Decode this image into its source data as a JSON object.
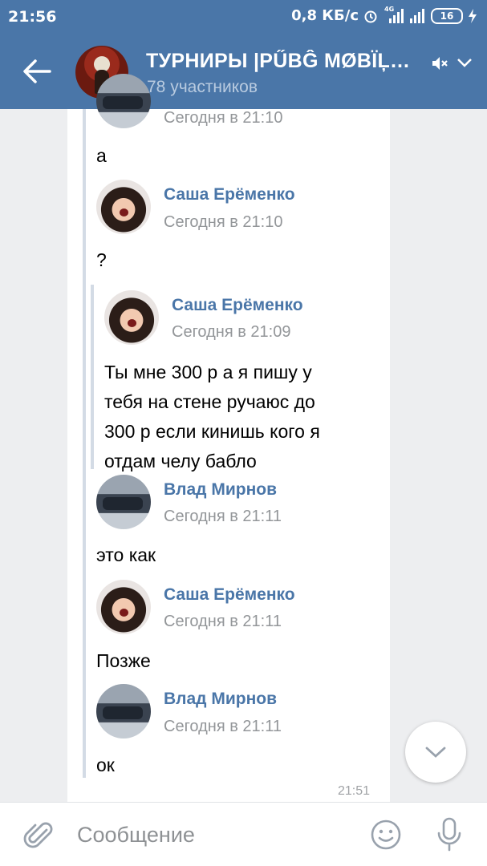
{
  "status_bar": {
    "time": "21:56",
    "net_speed": "0,8 КБ/с",
    "network_badge": "4G",
    "battery": "16"
  },
  "header": {
    "title": "ТУРНИРЫ |PŰBĜ MØBÏĻĘ... (",
    "subtitle": "78 участников"
  },
  "messages": [
    {
      "type": "text",
      "time": "Сегодня в 21:10",
      "text": "а"
    },
    {
      "type": "post",
      "author": "Саша Ерёменко",
      "time": "Сегодня в 21:10",
      "text": "?"
    },
    {
      "type": "quote",
      "author": "Саша Ерёменко",
      "time": "Сегодня в 21:09",
      "lines": [
        "Ты мне 300 р а я пишу у",
        "тебя на стене ручаюс до",
        "300 р если кинишь кого я",
        "отдам челу бабло"
      ]
    },
    {
      "type": "post",
      "author": "Влад Мирнов",
      "time": "Сегодня в 21:11",
      "text": "это как"
    },
    {
      "type": "post",
      "author": "Саша Ерёменко",
      "time": "Сегодня в 21:11",
      "text": "Позже"
    },
    {
      "type": "post",
      "author": "Влад Мирнов",
      "time": "Сегодня в 21:11",
      "text": "ок"
    }
  ],
  "message_time": "21:51",
  "composer": {
    "placeholder": "Сообщение"
  },
  "colors": {
    "header": "#4a76a8",
    "link": "#4a76a8",
    "background": "#edeef0"
  },
  "icons": [
    "back-arrow-icon",
    "mute-icon",
    "chevron-down-icon",
    "attach-icon",
    "smile-icon",
    "mic-icon",
    "scroll-down-icon"
  ]
}
